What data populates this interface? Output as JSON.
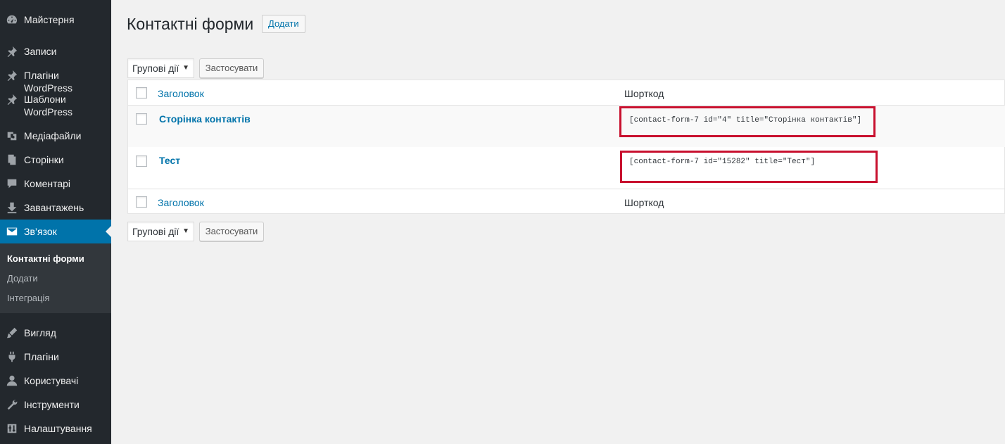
{
  "sidebar": {
    "items": [
      {
        "label": "Майстерня",
        "icon": "dashboard-icon"
      },
      {
        "label": "Записи",
        "icon": "pin-icon"
      },
      {
        "label": "Плагіни WordPress",
        "icon": "pin-icon"
      },
      {
        "label": "Шаблони WordPress",
        "icon": "pin-icon"
      },
      {
        "label": "Медіафайли",
        "icon": "media-icon"
      },
      {
        "label": "Сторінки",
        "icon": "pages-icon"
      },
      {
        "label": "Коментарі",
        "icon": "comments-icon"
      },
      {
        "label": "Завантажень",
        "icon": "download-icon"
      },
      {
        "label": "Зв’язок",
        "icon": "mail-icon"
      },
      {
        "label": "Вигляд",
        "icon": "appearance-icon"
      },
      {
        "label": "Плагіни",
        "icon": "plugins-icon"
      },
      {
        "label": "Користувачі",
        "icon": "users-icon"
      },
      {
        "label": "Інструменти",
        "icon": "tools-icon"
      },
      {
        "label": "Налаштування",
        "icon": "settings-icon"
      }
    ],
    "submenu": [
      "Контактні форми",
      "Додати",
      "Інтеграція"
    ]
  },
  "page": {
    "title": "Контактні форми",
    "add_new": "Додати"
  },
  "bulk": {
    "select_label": "Групові дії",
    "apply_label": "Застосувати"
  },
  "table": {
    "headers": {
      "title": "Заголовок",
      "shortcode": "Шорткод"
    },
    "rows": [
      {
        "title": "Сторінка контактів",
        "shortcode": "[contact-form-7 id=\"4\" title=\"Сторінка контактів\"]"
      },
      {
        "title": "Тест",
        "shortcode": "[contact-form-7 id=\"15282\" title=\"Тест\"]"
      }
    ]
  },
  "colors": {
    "sidebar_bg": "#23282d",
    "active_bg": "#0073aa",
    "link": "#0073aa",
    "highlight": "#c8102e"
  }
}
